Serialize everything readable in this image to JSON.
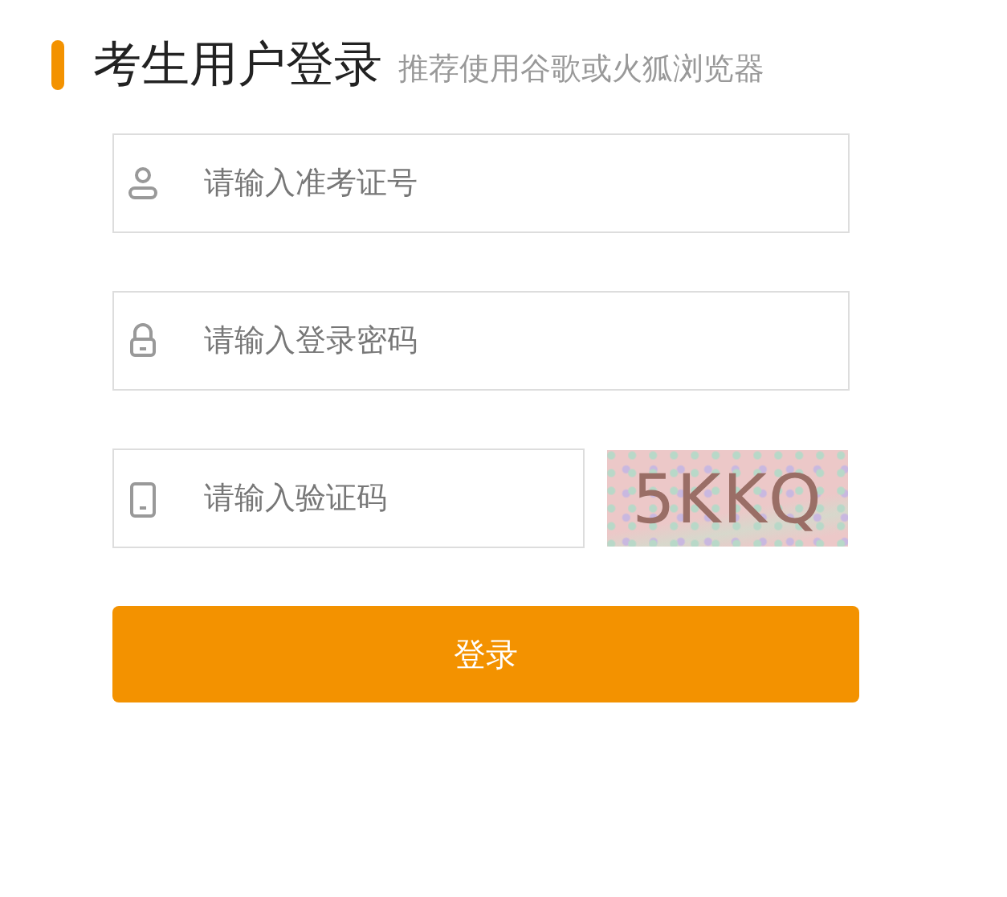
{
  "header": {
    "title": "考生用户登录",
    "subtitle": "推荐使用谷歌或火狐浏览器"
  },
  "fields": [
    {
      "kind": "user",
      "placeholder": "请输入准考证号"
    },
    {
      "kind": "lock",
      "placeholder": "请输入登录密码"
    },
    {
      "kind": "phone",
      "placeholder": "请输入验证码",
      "captcha": "5KKQ"
    }
  ],
  "button": "登录"
}
